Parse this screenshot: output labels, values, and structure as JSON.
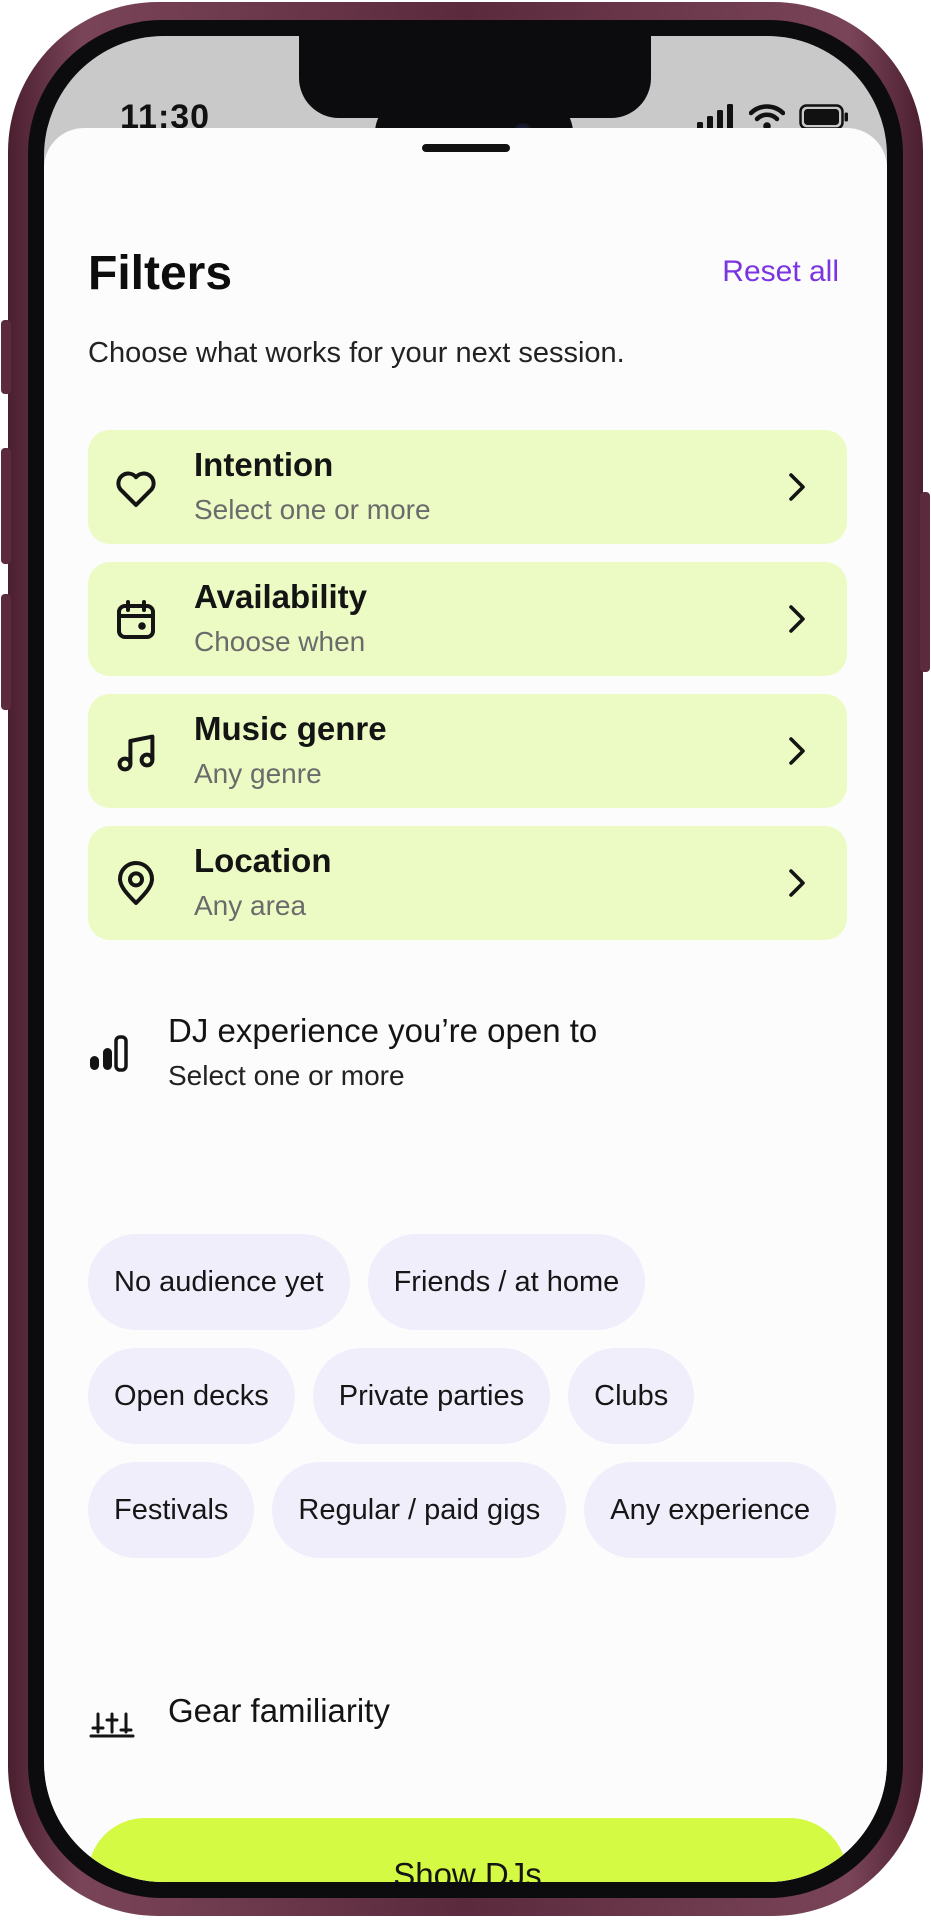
{
  "status_bar": {
    "time": "11:30"
  },
  "header": {
    "title": "Filters",
    "reset_label": "Reset all",
    "subtitle": "Choose what works for your next session."
  },
  "filters": [
    {
      "title": "Intention",
      "subtitle": "Select one or more",
      "icon": "heart-icon"
    },
    {
      "title": "Availability",
      "subtitle": "Choose when",
      "icon": "calendar-icon"
    },
    {
      "title": "Music genre",
      "subtitle": "Any genre",
      "icon": "music-note-icon"
    },
    {
      "title": "Location",
      "subtitle": "Any area",
      "icon": "location-pin-icon"
    }
  ],
  "experience": {
    "title": "DJ experience you’re open to",
    "subtitle": "Select one or more",
    "icon": "signal-bars-icon",
    "options": [
      "No audience yet",
      "Friends / at home",
      "Open decks",
      "Private parties",
      "Clubs",
      "Festivals",
      "Regular / paid gigs",
      "Any experience"
    ]
  },
  "gear": {
    "title": "Gear familiarity",
    "icon": "sliders-icon"
  },
  "cta": {
    "label": "Show DJs"
  },
  "colors": {
    "accent_purple": "#7a35e0",
    "row_background": "#ecfbc4",
    "chip_background": "#f1eefc",
    "cta_background": "#d4fa44"
  }
}
